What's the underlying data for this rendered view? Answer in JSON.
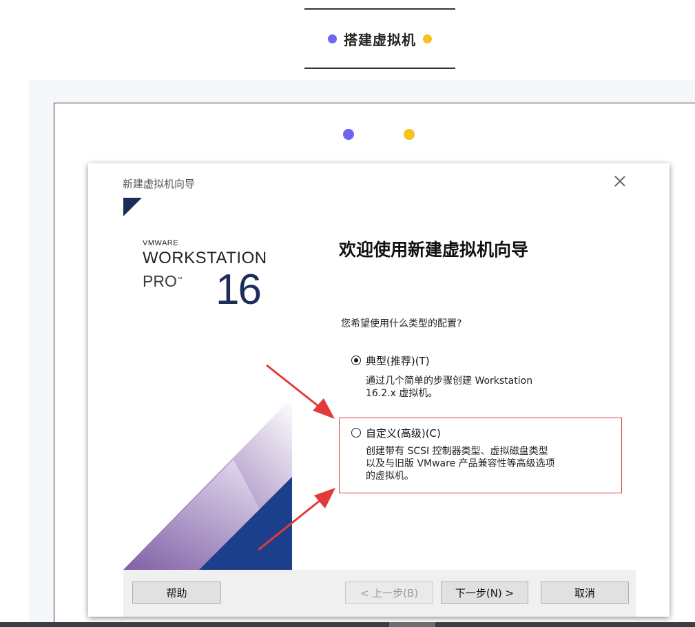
{
  "section_heading": {
    "text": "搭建虚拟机",
    "dot_colors": [
      "#6e64f5",
      "#f6c21d"
    ]
  },
  "dialog": {
    "title": "新建虚拟机向导",
    "brand": {
      "company": "VMWARE",
      "product": "WORKSTATION",
      "edition": "PRO",
      "trademark": "™",
      "version": "16"
    },
    "welcome_title": "欢迎使用新建虚拟机向导",
    "question": "您希望使用什么类型的配置?",
    "options": [
      {
        "label": "典型(推荐)(T)",
        "desc_lines": [
          "通过几个简单的步骤创建 Workstation",
          "16.2.x 虚拟机。"
        ],
        "selected": true
      },
      {
        "label": "自定义(高级)(C)",
        "desc_lines": [
          "创建带有 SCSI 控制器类型、虚拟磁盘类型",
          "以及与旧版 VMware 产品兼容性等高级选项",
          "的虚拟机。"
        ],
        "selected": false
      }
    ],
    "buttons": {
      "help": "帮助",
      "back": "< 上一步(B)",
      "next": "下一步(N) >",
      "cancel": "取消"
    }
  },
  "colors": {
    "accent_red": "#e23a3a",
    "brand_navy": "#1c2d5a",
    "brand_purple": "#7b5aa6"
  },
  "icons": [
    "close-icon",
    "radio-selected-icon",
    "radio-empty-icon",
    "red-arrow-icon"
  ]
}
